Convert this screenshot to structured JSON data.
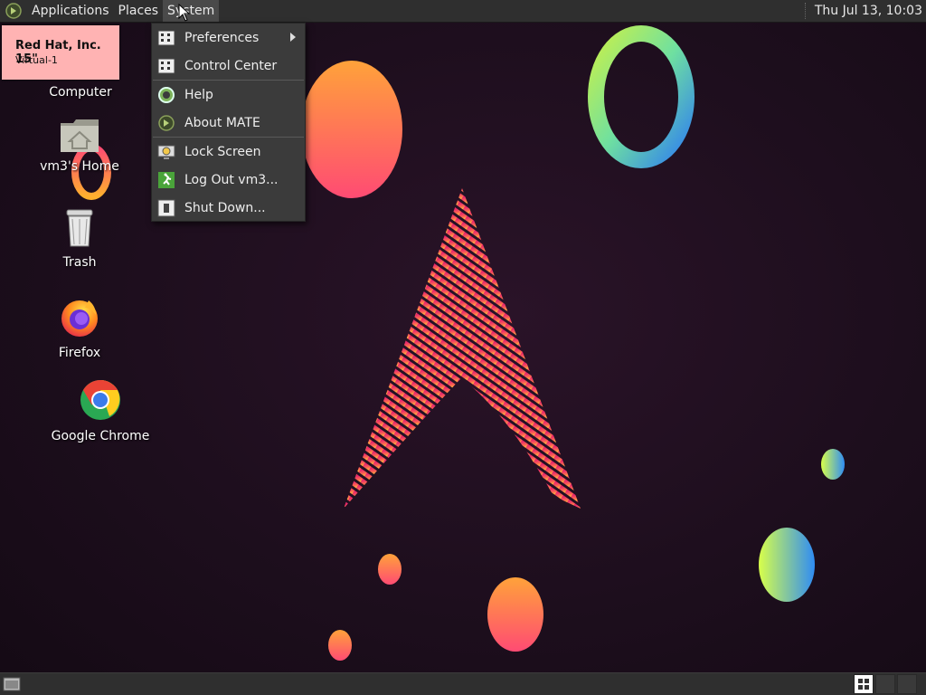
{
  "panel": {
    "applications": "Applications",
    "places": "Places",
    "system": "System",
    "clock": "Thu Jul 13, 10:03"
  },
  "notification": {
    "title": "Red Hat, Inc. 15\"",
    "body": "Virtual-1"
  },
  "desktop_icons": {
    "computer": "Computer",
    "home": "vm3's Home",
    "trash": "Trash",
    "firefox": "Firefox",
    "chrome": "Google Chrome"
  },
  "system_menu": {
    "items": [
      {
        "label": "Preferences",
        "icon": "preferences-icon",
        "submenu": true
      },
      {
        "label": "Control Center",
        "icon": "control-center-icon"
      },
      {
        "label": "Help",
        "icon": "help-icon"
      },
      {
        "label": "About MATE",
        "icon": "mate-logo-icon"
      },
      {
        "label": "Lock Screen",
        "icon": "lock-screen-icon"
      },
      {
        "label": "Log Out vm3...",
        "icon": "log-out-icon"
      },
      {
        "label": "Shut Down...",
        "icon": "shut-down-icon"
      }
    ]
  },
  "colors": {
    "panel": "#2f2f2f",
    "menu_bg": "#3b3b3b",
    "notification_bg": "#ffb3b3",
    "wallpaper_bg": "#1d0e1d"
  }
}
